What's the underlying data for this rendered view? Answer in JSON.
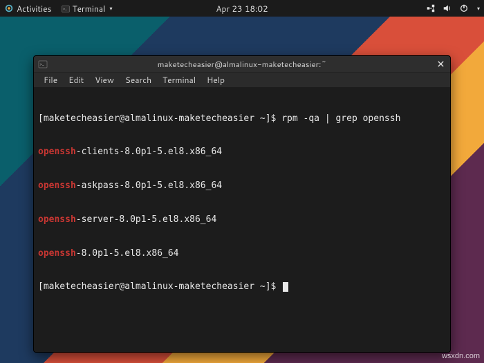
{
  "topbar": {
    "activities_label": "Activities",
    "app_menu_label": "Terminal",
    "clock": "Apr 23  18:02"
  },
  "window": {
    "title": "maketecheasier@almalinux-maketecheasier:~"
  },
  "menubar": {
    "file": "File",
    "edit": "Edit",
    "view": "View",
    "search": "Search",
    "terminal": "Terminal",
    "help": "Help"
  },
  "terminal": {
    "prompt_prefix": "[maketecheasier@almalinux-maketecheasier ~]$ ",
    "command1": "rpm -qa | grep openssh",
    "lines": [
      {
        "match": "openssh",
        "rest": "-clients-8.0p1-5.el8.x86_64"
      },
      {
        "match": "openssh",
        "rest": "-askpass-8.0p1-5.el8.x86_64"
      },
      {
        "match": "openssh",
        "rest": "-server-8.0p1-5.el8.x86_64"
      },
      {
        "match": "openssh",
        "rest": "-8.0p1-5.el8.x86_64"
      }
    ]
  },
  "watermark": "wsxdn.com"
}
